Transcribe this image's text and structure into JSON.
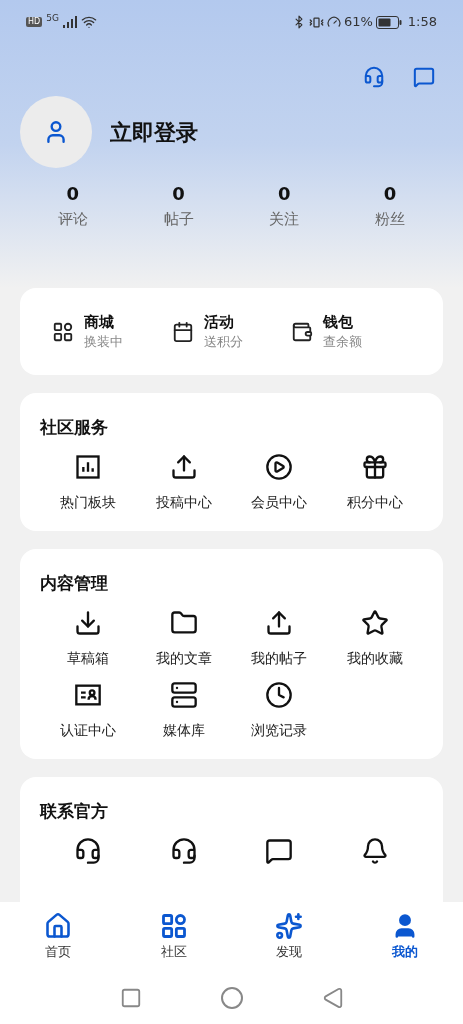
{
  "status_bar": {
    "hd": "HD",
    "network": "5G",
    "battery": "61%",
    "time": "1:58"
  },
  "profile": {
    "login": "立即登录"
  },
  "stats": [
    {
      "value": "0",
      "label": "评论"
    },
    {
      "value": "0",
      "label": "帖子"
    },
    {
      "value": "0",
      "label": "关注"
    },
    {
      "value": "0",
      "label": "粉丝"
    }
  ],
  "quick_links": [
    {
      "title": "商城",
      "subtitle": "换装中"
    },
    {
      "title": "活动",
      "subtitle": "送积分"
    },
    {
      "title": "钱包",
      "subtitle": "查余额"
    }
  ],
  "sections": [
    {
      "title": "社区服务",
      "items": [
        "热门板块",
        "投稿中心",
        "会员中心",
        "积分中心"
      ]
    },
    {
      "title": "内容管理",
      "items": [
        "草稿箱",
        "我的文章",
        "我的帖子",
        "我的收藏",
        "认证中心",
        "媒体库",
        "浏览记录"
      ]
    },
    {
      "title": "联系官方"
    }
  ],
  "bottom_nav": [
    {
      "label": "首页",
      "selected": false
    },
    {
      "label": "社区",
      "selected": false
    },
    {
      "label": "发现",
      "selected": false
    },
    {
      "label": "我的",
      "selected": true
    }
  ]
}
